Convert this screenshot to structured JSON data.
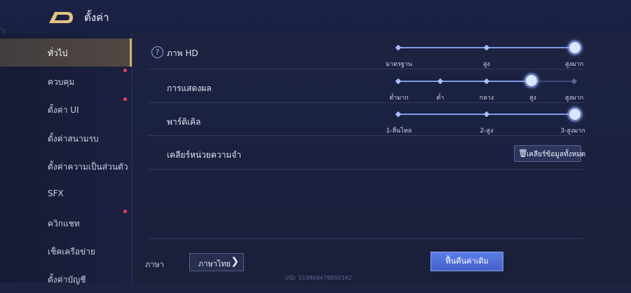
{
  "header": {
    "title": "ตั้งค่า",
    "back_icon": "back-arrow-icon"
  },
  "sidebar": {
    "items": [
      {
        "label": "ทั่วไป",
        "active": true,
        "badge": false
      },
      {
        "label": "ควบคุม",
        "active": false,
        "badge": true
      },
      {
        "label": "ตั้งค่า UI",
        "active": false,
        "badge": true
      },
      {
        "label": "ตั้งค่าสนามรบ",
        "active": false,
        "badge": false
      },
      {
        "label": "ตั้งค่าความเป็นส่วนตัว",
        "active": false,
        "badge": false
      },
      {
        "label": "SFX",
        "active": false,
        "badge": false
      },
      {
        "label": "ควิกแชท",
        "active": false,
        "badge": true
      },
      {
        "label": "เช็คเครือข่าย",
        "active": false,
        "badge": false
      },
      {
        "label": "ตั้งค่าบัญชี",
        "active": false,
        "badge": false
      }
    ]
  },
  "settings": {
    "graphics": {
      "label": "ภาพ HD",
      "help_icon": "?",
      "options": [
        "มาตรฐาน",
        "สูง",
        "สูงมาก"
      ],
      "selected_index": 2
    },
    "display": {
      "label": "การแสดงผล",
      "options": [
        "ต่ำมาก",
        "ต่ำ",
        "กลาง",
        "สูง",
        "สูงมาก"
      ],
      "selected_index": 3
    },
    "particles": {
      "label": "พาร์ติเคิล",
      "options": [
        "1-ลื่นไหล",
        "2-สูง",
        "3-สูงมาก"
      ],
      "selected_index": 2
    },
    "memory": {
      "label": "เคลียร์หน่วยความจำ",
      "button_label": "เคลียร์ข้อมูลทั้งหมด",
      "button_icon": "trash-icon"
    }
  },
  "footer": {
    "language_label": "ภาษา",
    "language_value": "ภาษาไทย",
    "reset_label": "ฟื้นคืนค่าเดิม",
    "uid_text": "UID: 519868478850162"
  },
  "colors": {
    "accent": "#d4b06a",
    "slider": "#7d9bea",
    "badge": "#ff3b5c",
    "primary_button": "#5070da"
  }
}
